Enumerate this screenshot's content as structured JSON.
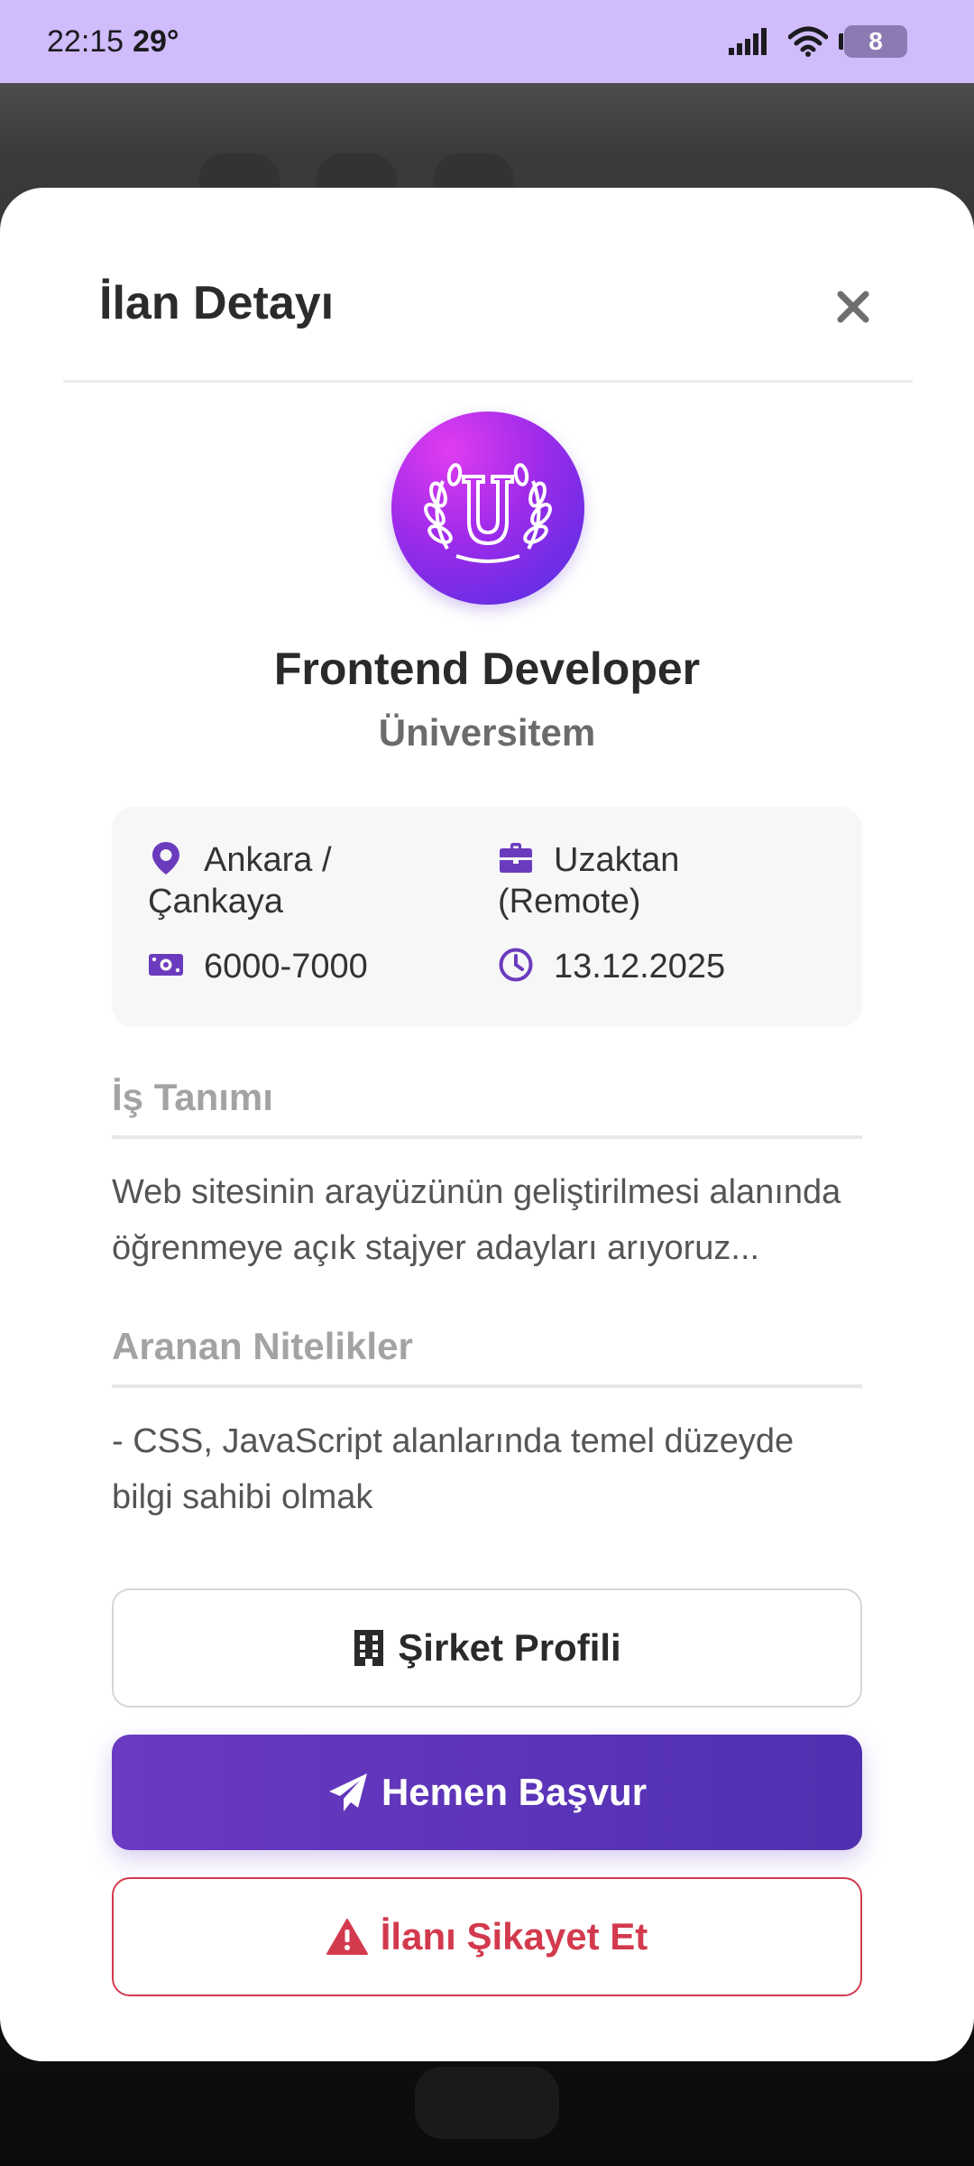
{
  "status_bar": {
    "time": "22:15",
    "temperature": "29°",
    "battery": "8"
  },
  "modal": {
    "title": "İlan Detayı",
    "job_title": "Frontend Developer",
    "company": "Üniversitem",
    "info": {
      "location_line1": "Ankara /",
      "location_line2": "Çankaya",
      "work_type_line1": "Uzaktan",
      "work_type_line2": "(Remote)",
      "salary": "6000-7000",
      "date": "13.12.2025"
    },
    "job_description": {
      "heading": "İş Tanımı",
      "text": "Web sitesinin arayüzünün geliştirilmesi alanında öğrenmeye açık stajyer adayları arıyoruz..."
    },
    "qualifications": {
      "heading": "Aranan Nitelikler",
      "text": "- CSS, JavaScript alanlarında temel düzeyde bilgi sahibi olmak"
    },
    "buttons": {
      "company_profile": "Şirket Profili",
      "apply": "Hemen Başvur",
      "report": "İlanı Şikayet Et"
    }
  },
  "icons": {
    "location": "map-pin-icon",
    "work_type": "briefcase-icon",
    "salary": "money-icon",
    "date": "clock-icon",
    "profile": "building-icon",
    "apply": "paper-plane-icon",
    "report": "warning-icon"
  },
  "colors": {
    "status_bar": "#d0bcfb",
    "accent": "#6a3ac2",
    "icon_purple": "#6b3bbd",
    "danger": "#d33a4e",
    "logo_gradient_start": "#e03cf0",
    "logo_gradient_end": "#4b2fe0"
  }
}
